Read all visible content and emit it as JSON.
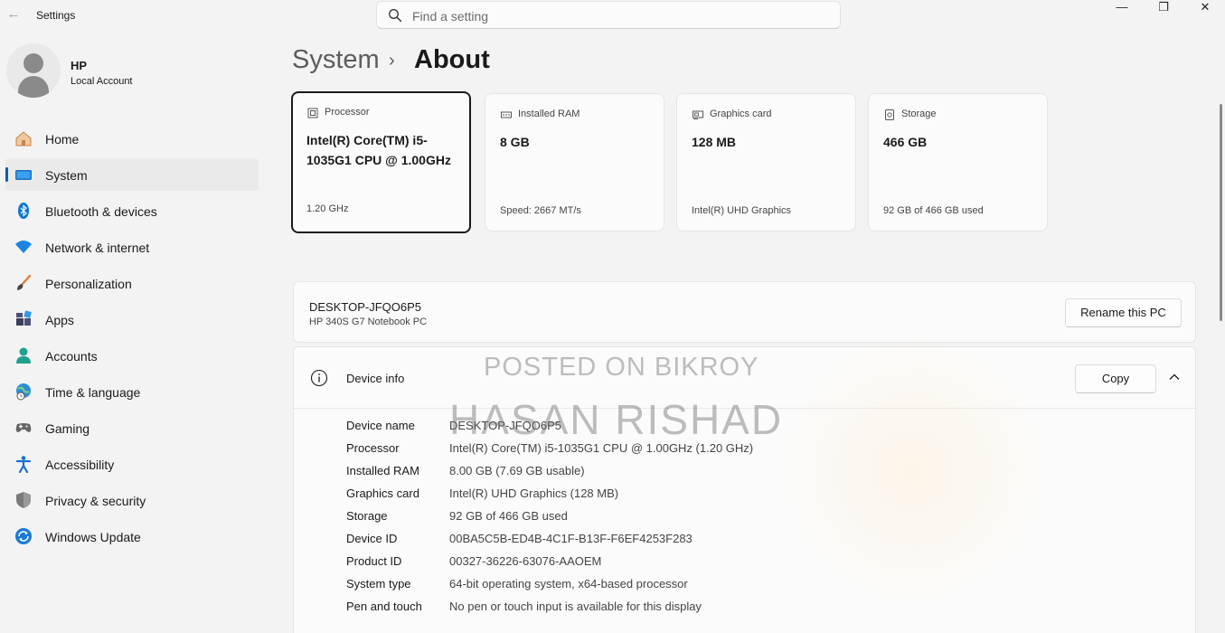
{
  "window": {
    "title": "Settings",
    "minimize_glyph": "—",
    "maximize_glyph": "❐",
    "close_glyph": "✕",
    "back_glyph": "←"
  },
  "search": {
    "placeholder": "Find a setting"
  },
  "profile": {
    "name": "HP",
    "account_type": "Local Account"
  },
  "sidebar": {
    "items": [
      {
        "label": "Home",
        "icon": "home-icon"
      },
      {
        "label": "System",
        "icon": "system-icon",
        "active": true
      },
      {
        "label": "Bluetooth & devices",
        "icon": "bluetooth-icon"
      },
      {
        "label": "Network & internet",
        "icon": "wifi-icon"
      },
      {
        "label": "Personalization",
        "icon": "brush-icon"
      },
      {
        "label": "Apps",
        "icon": "apps-icon"
      },
      {
        "label": "Accounts",
        "icon": "accounts-icon"
      },
      {
        "label": "Time & language",
        "icon": "globe-clock-icon"
      },
      {
        "label": "Gaming",
        "icon": "gamepad-icon"
      },
      {
        "label": "Accessibility",
        "icon": "accessibility-icon"
      },
      {
        "label": "Privacy & security",
        "icon": "shield-icon"
      },
      {
        "label": "Windows Update",
        "icon": "update-icon"
      }
    ]
  },
  "breadcrumb": {
    "parent": "System",
    "separator": "›",
    "current": "About"
  },
  "cards": [
    {
      "label": "Processor",
      "value": "Intel(R) Core(TM) i5-1035G1 CPU @ 1.00GHz",
      "sub": "1.20 GHz",
      "icon": "processor-icon"
    },
    {
      "label": "Installed RAM",
      "value": "8 GB",
      "sub": "Speed: 2667 MT/s",
      "icon": "ram-icon"
    },
    {
      "label": "Graphics card",
      "value": "128 MB",
      "sub": "Intel(R) UHD Graphics",
      "icon": "graphics-card-icon"
    },
    {
      "label": "Storage",
      "value": "466 GB",
      "sub": "92 GB of 466 GB used",
      "icon": "storage-icon"
    }
  ],
  "pc": {
    "name": "DESKTOP-JFQO6P5",
    "model": "HP 340S G7 Notebook PC",
    "rename_label": "Rename this PC"
  },
  "device_info": {
    "title": "Device info",
    "copy_label": "Copy",
    "rows": [
      {
        "key": "Device name",
        "value": "DESKTOP-JFQO6P5"
      },
      {
        "key": "Processor",
        "value": "Intel(R) Core(TM) i5-1035G1 CPU @ 1.00GHz (1.20 GHz)"
      },
      {
        "key": "Installed RAM",
        "value": "8.00 GB (7.69 GB usable)"
      },
      {
        "key": "Graphics card",
        "value": "Intel(R) UHD Graphics (128 MB)"
      },
      {
        "key": "Storage",
        "value": "92 GB of 466 GB used"
      },
      {
        "key": "Device ID",
        "value": "00BA5C5B-ED4B-4C1F-B13F-F6EF4253F283"
      },
      {
        "key": "Product ID",
        "value": "00327-36226-63076-AAOEM"
      },
      {
        "key": "System type",
        "value": "64-bit operating system, x64-based processor"
      },
      {
        "key": "Pen and touch",
        "value": "No pen or touch input is available for this display"
      }
    ]
  },
  "watermark": {
    "line1": "POSTED ON BIKROY",
    "line2": "HASAN RISHAD"
  },
  "colors": {
    "accent": "#005fb8",
    "background": "#f3f3f3",
    "card": "#fbfbfb"
  }
}
